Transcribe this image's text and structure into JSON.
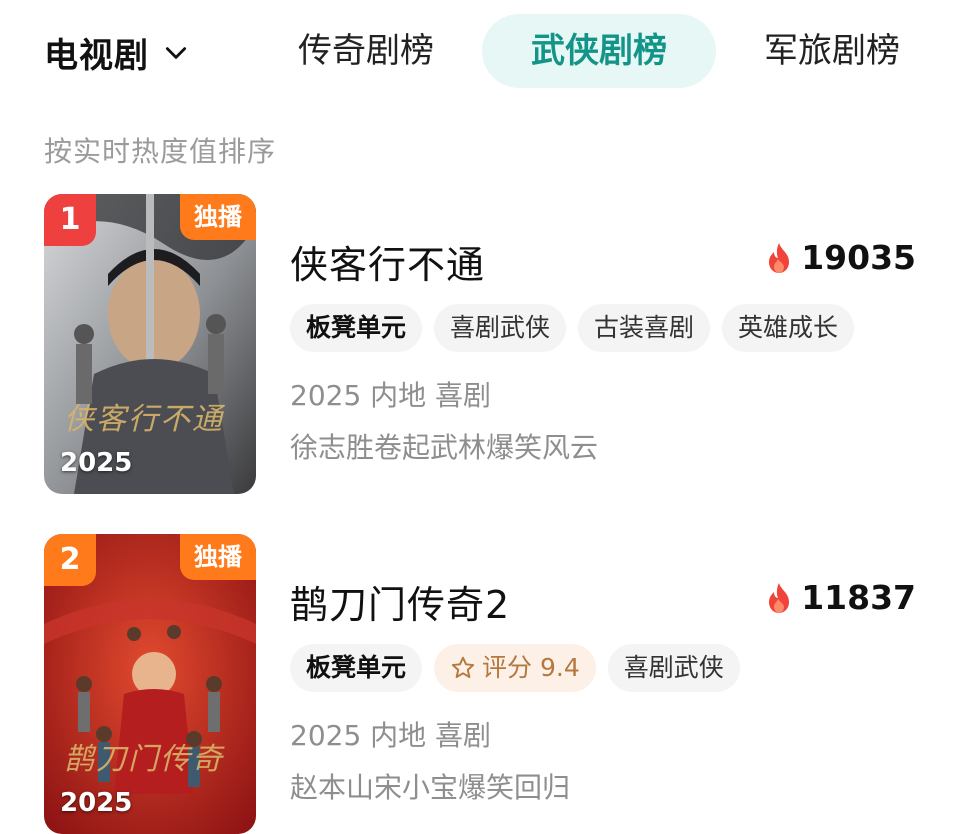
{
  "header": {
    "category": "电视剧",
    "tabs": [
      "传奇剧榜",
      "武侠剧榜",
      "军旅剧榜"
    ],
    "active_tab": "武侠剧榜",
    "sort_hint": "按实时热度值排序"
  },
  "items": [
    {
      "rank": "1",
      "badge": "独播",
      "poster_year": "2025",
      "poster_title": "侠客行不通",
      "title": "侠客行不通",
      "heat": "19035",
      "tags": [
        "板凳单元",
        "喜剧武侠",
        "古装喜剧",
        "英雄成长"
      ],
      "meta": "2025 内地 喜剧",
      "desc": "徐志胜卷起武林爆笑风云"
    },
    {
      "rank": "2",
      "badge": "独播",
      "poster_year": "2025",
      "poster_title": "鹊刀门传奇",
      "title": "鹊刀门传奇2",
      "heat": "11837",
      "tag_first": "板凳单元",
      "rating": "评分 9.4",
      "tag_last": "喜剧武侠",
      "meta": "2025 内地 喜剧",
      "desc": "赵本山宋小宝爆笑回归"
    }
  ],
  "colors": {
    "accent": "#139488",
    "accent_bg": "#e6f7f5",
    "rank_1": "#ef4040",
    "rank_2": "#ff7a1a",
    "flame": "#f0443a"
  },
  "icons": {
    "dropdown": "chevron-down-icon",
    "heat": "flame-icon",
    "rating": "star-icon"
  }
}
